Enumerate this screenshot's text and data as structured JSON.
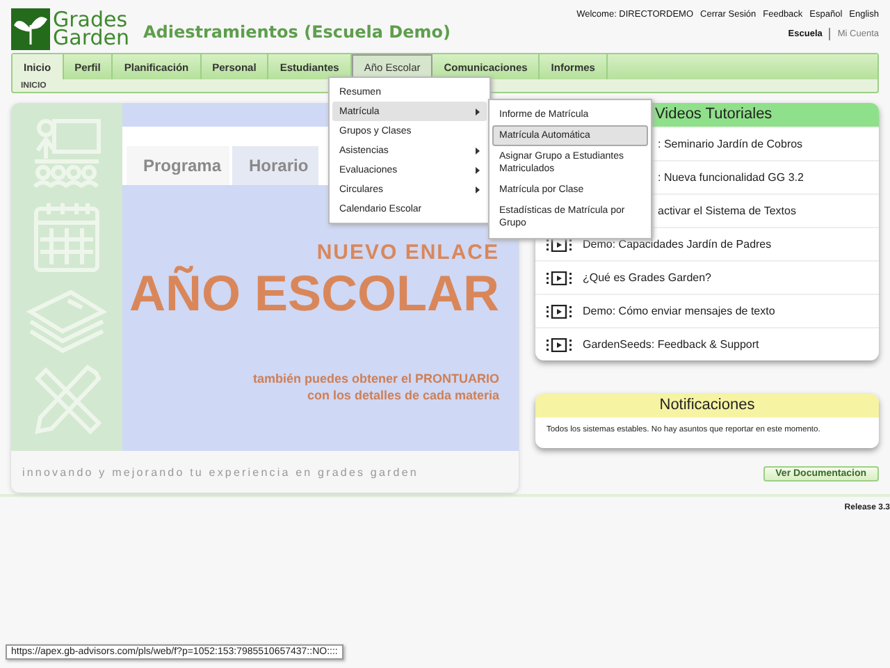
{
  "header": {
    "logo_text": [
      "Grades",
      "Garden"
    ],
    "title": "Adiestramientos (Escuela Demo)",
    "user_links": [
      "Welcome: DIRECTORDEMO",
      "Cerrar Sesión",
      "Feedback",
      "Español",
      "English"
    ],
    "context_links": [
      {
        "label": "Escuela",
        "selected": true
      },
      {
        "label": "Mi Cuenta",
        "selected": false
      }
    ]
  },
  "nav": {
    "tabs": [
      {
        "label": "Inicio",
        "selected": true,
        "open": false
      },
      {
        "label": "Perfil",
        "selected": false,
        "open": false
      },
      {
        "label": "Planificación",
        "selected": false,
        "open": false
      },
      {
        "label": "Personal",
        "selected": false,
        "open": false
      },
      {
        "label": "Estudiantes",
        "selected": false,
        "open": false
      },
      {
        "label": "Año Escolar",
        "selected": false,
        "open": true
      },
      {
        "label": "Comunicaciones",
        "selected": false,
        "open": false
      },
      {
        "label": "Informes",
        "selected": false,
        "open": false
      }
    ],
    "breadcrumb": "INICIO"
  },
  "menu": {
    "items": [
      {
        "label": "Resumen",
        "has_submenu": false,
        "highlighted": false
      },
      {
        "label": "Matrícula",
        "has_submenu": true,
        "highlighted": true
      },
      {
        "label": "Grupos y Clases",
        "has_submenu": false,
        "highlighted": false
      },
      {
        "label": "Asistencias",
        "has_submenu": true,
        "highlighted": false
      },
      {
        "label": "Evaluaciones",
        "has_submenu": true,
        "highlighted": false
      },
      {
        "label": "Circulares",
        "has_submenu": true,
        "highlighted": false
      },
      {
        "label": "Calendario Escolar",
        "has_submenu": false,
        "highlighted": false
      }
    ],
    "submenu": [
      {
        "label": "Informe de Matrícula",
        "highlighted": false
      },
      {
        "label": "Matrícula Automática",
        "highlighted": true
      },
      {
        "label": "Asignar Grupo a Estudiantes Matriculados",
        "highlighted": false
      },
      {
        "label": "Matrícula por Clase",
        "highlighted": false
      },
      {
        "label": "Estadísticas de Matrícula por Grupo",
        "highlighted": false
      }
    ]
  },
  "banner": {
    "tabs": [
      {
        "label": "Programa",
        "selected": true
      },
      {
        "label": "Horario",
        "selected": false
      }
    ],
    "kicker": "NUEVO ENLACE",
    "headline": "AÑO ESCOLAR",
    "subtitle": [
      "también puedes obtener el PRONTUARIO",
      "con los detalles de cada materia"
    ],
    "tagline": "innovando y mejorando tu experiencia en grades garden"
  },
  "videos": {
    "title": "Videos Tutoriales",
    "items": [
      {
        "label": ": Seminario Jardín de Cobros",
        "covered": true
      },
      {
        "label": ": Nueva funcionalidad GG 3.2",
        "covered": true
      },
      {
        "label": "activar el Sistema de Textos",
        "covered": true
      },
      {
        "label": "Demo: Capacidades Jardín de Padres",
        "covered": false
      },
      {
        "label": "¿Qué es Grades Garden?",
        "covered": false
      },
      {
        "label": "Demo: Cómo enviar mensajes de texto",
        "covered": false
      },
      {
        "label": "GardenSeeds: Feedback & Support",
        "covered": false
      }
    ]
  },
  "notifications": {
    "title": "Notificaciones",
    "message": "Todos los sistemas estables. No hay asuntos que reportar en este momento."
  },
  "docs_button": "Ver Documentacion",
  "release": "Release 3.3",
  "status_url": "https://apex.gb-advisors.com/pls/web/f?p=1052:153:7985510657437::NO::::"
}
